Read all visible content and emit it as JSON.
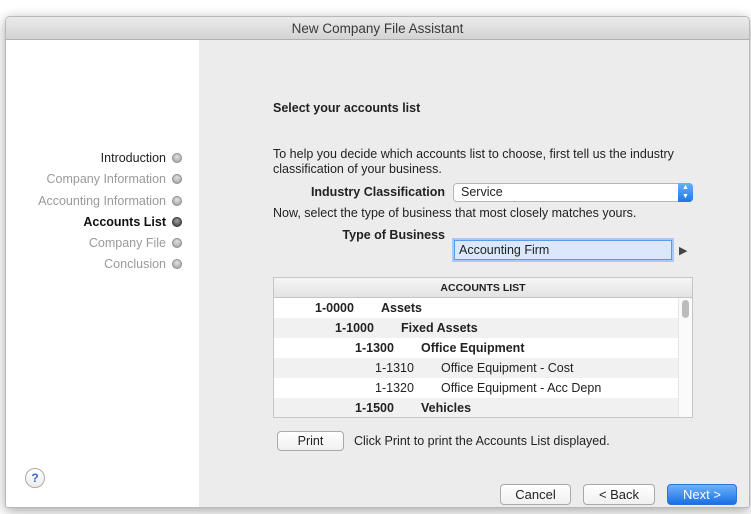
{
  "window": {
    "title": "New Company File Assistant"
  },
  "sidebar": {
    "steps": [
      {
        "label": "Introduction",
        "state": "done"
      },
      {
        "label": "Company Information",
        "state": "pending"
      },
      {
        "label": "Accounting Information",
        "state": "pending"
      },
      {
        "label": "Accounts List",
        "state": "current"
      },
      {
        "label": "Company File",
        "state": "pending"
      },
      {
        "label": "Conclusion",
        "state": "pending"
      }
    ],
    "help_label": "?"
  },
  "main": {
    "heading": "Select your accounts list",
    "intro": "To help you decide which accounts list to choose, first tell us the industry classification of your business.",
    "industry_label": "Industry Classification",
    "industry_value": "Service",
    "instruction": "Now, select the type of business that most closely matches yours.",
    "type_label": "Type of Business",
    "type_value": "Accounting Firm",
    "accounts_list": {
      "header": "ACCOUNTS LIST",
      "rows": [
        {
          "code": "1-0000",
          "name": "Assets",
          "level": 0
        },
        {
          "code": "1-1000",
          "name": "Fixed Assets",
          "level": 1
        },
        {
          "code": "1-1300",
          "name": "Office Equipment",
          "level": 2
        },
        {
          "code": "1-1310",
          "name": "Office Equipment - Cost",
          "level": 3
        },
        {
          "code": "1-1320",
          "name": "Office Equipment - Acc Depn",
          "level": 3
        },
        {
          "code": "1-1500",
          "name": "Vehicles",
          "level": 2
        }
      ]
    },
    "print_label": "Print",
    "print_hint": "Click Print to print the Accounts List displayed."
  },
  "footer": {
    "cancel_label": "Cancel",
    "back_label": "< Back",
    "next_label": "Next >"
  }
}
